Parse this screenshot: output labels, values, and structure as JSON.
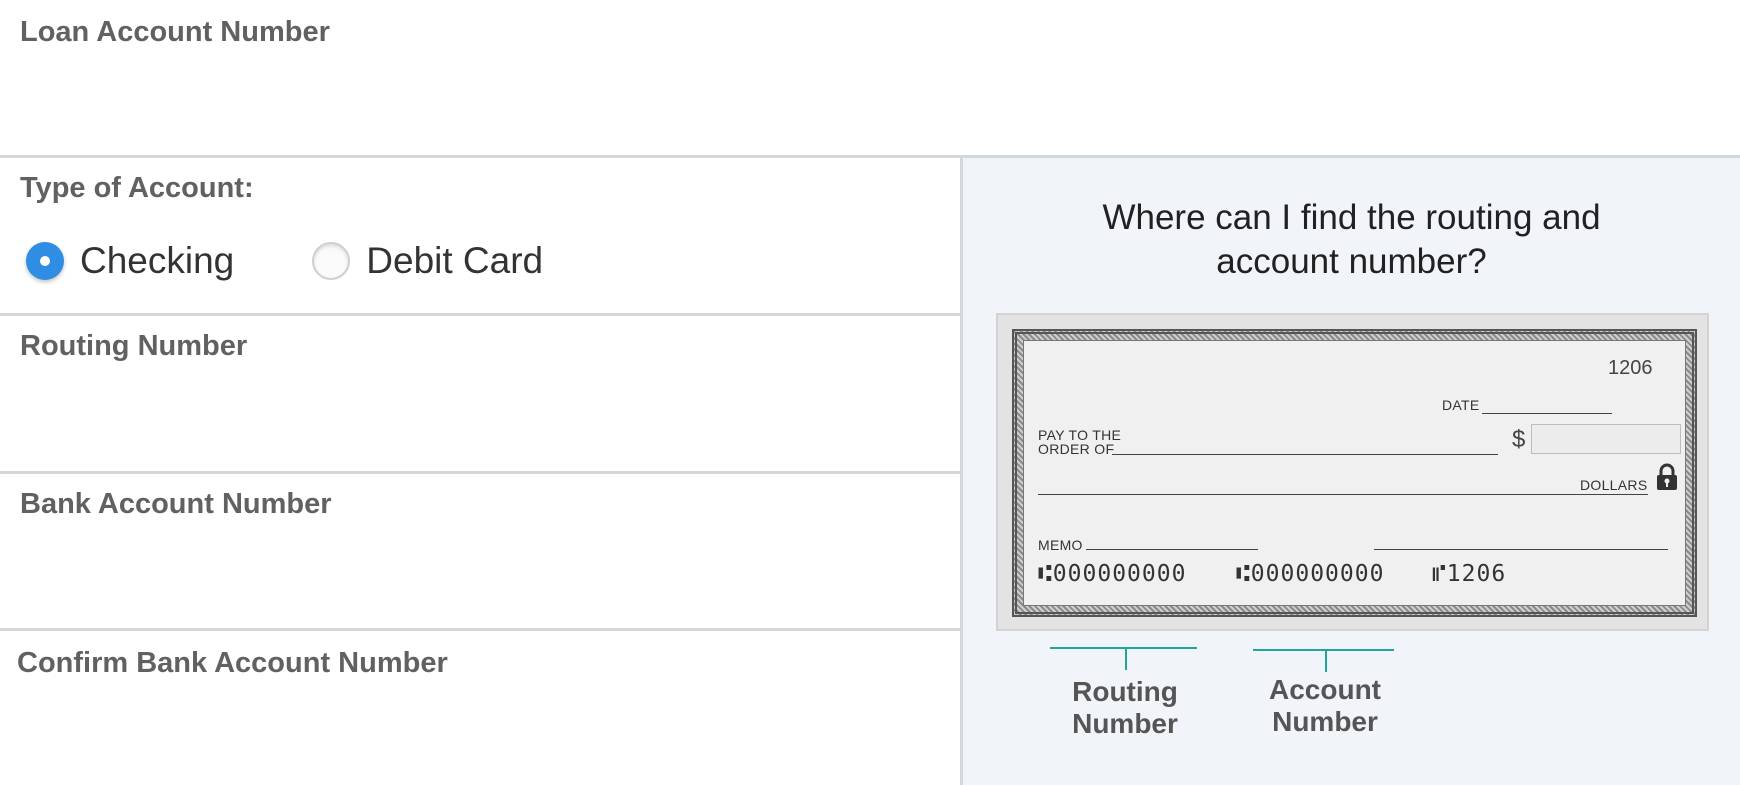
{
  "form": {
    "loan_account_label": "Loan Account Number",
    "type_of_account_label": "Type of Account:",
    "account_types": [
      {
        "label": "Checking",
        "selected": true
      },
      {
        "label": "Debit Card",
        "selected": false
      }
    ],
    "routing_label": "Routing Number",
    "bank_account_label": "Bank Account Number",
    "confirm_bank_account_label": "Confirm Bank Account Number"
  },
  "help": {
    "title": "Where can I find the routing and\naccount number?",
    "check": {
      "check_number": "1206",
      "date_label": "DATE",
      "pay_to_line1": "PAY TO THE",
      "pay_to_line2": "ORDER OF",
      "dollar_sign": "$",
      "dollars_label": "DOLLARS",
      "memo_label": "MEMO",
      "micr_routing": "⑆000000000",
      "micr_account": "⑆000000000",
      "micr_check": "⑈1206"
    },
    "routing_caption": "Routing\nNumber",
    "account_caption": "Account\nNumber"
  },
  "colors": {
    "radio_selected": "#2f8de4",
    "bracket": "#1fa896",
    "panel_bg": "#f1f5fa"
  },
  "icons": {
    "lock": "lock-icon"
  }
}
